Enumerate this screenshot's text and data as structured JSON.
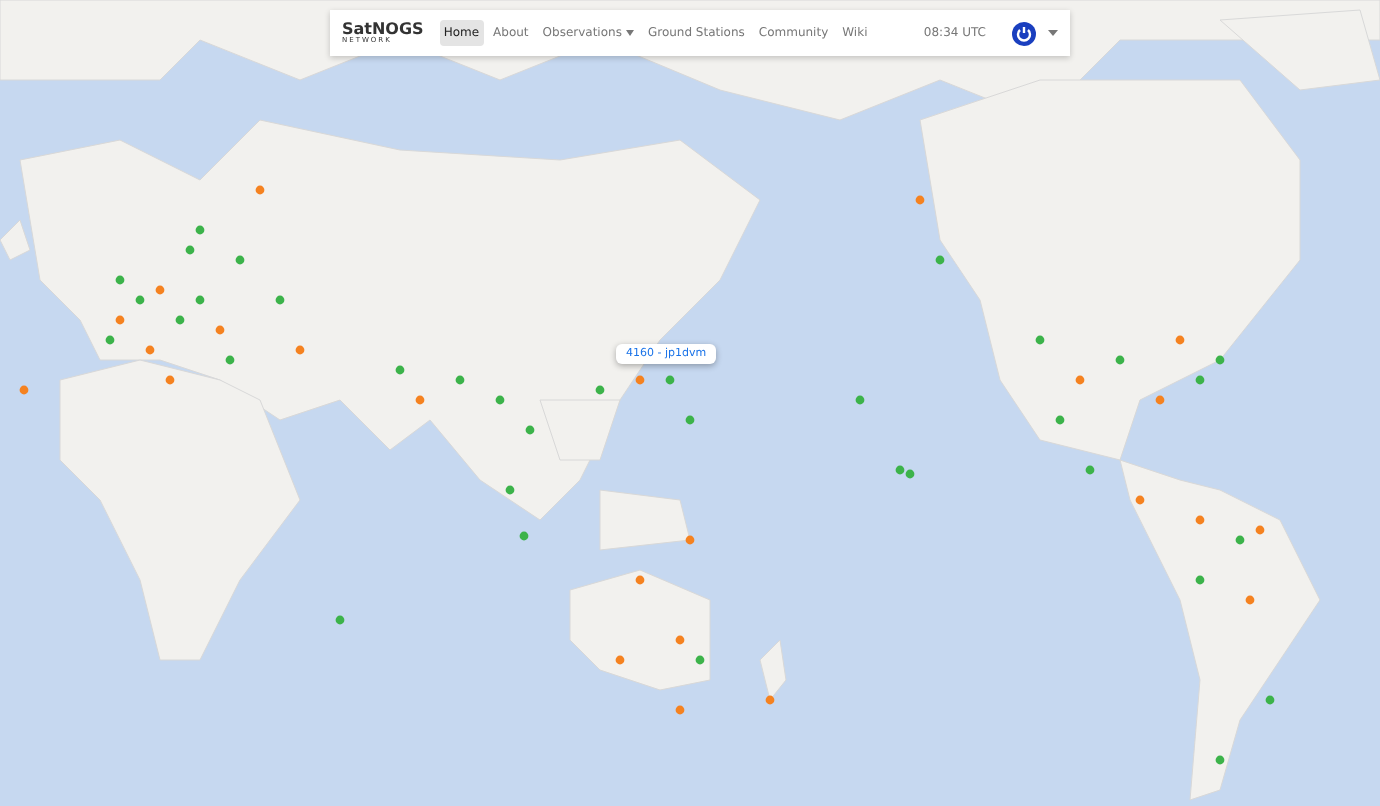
{
  "navbar": {
    "logo": {
      "title": "SatNOGS",
      "subtitle": "NETWORK"
    },
    "items": [
      {
        "label": "Home",
        "selected": true,
        "dropdown": false
      },
      {
        "label": "About",
        "selected": false,
        "dropdown": false
      },
      {
        "label": "Observations",
        "selected": false,
        "dropdown": true
      },
      {
        "label": "Ground Stations",
        "selected": false,
        "dropdown": false
      },
      {
        "label": "Community",
        "selected": false,
        "dropdown": false
      },
      {
        "label": "Wiki",
        "selected": false,
        "dropdown": false
      }
    ],
    "clock": "08:34 UTC"
  },
  "map": {
    "tooltip": "4160 - jp1dvm"
  }
}
